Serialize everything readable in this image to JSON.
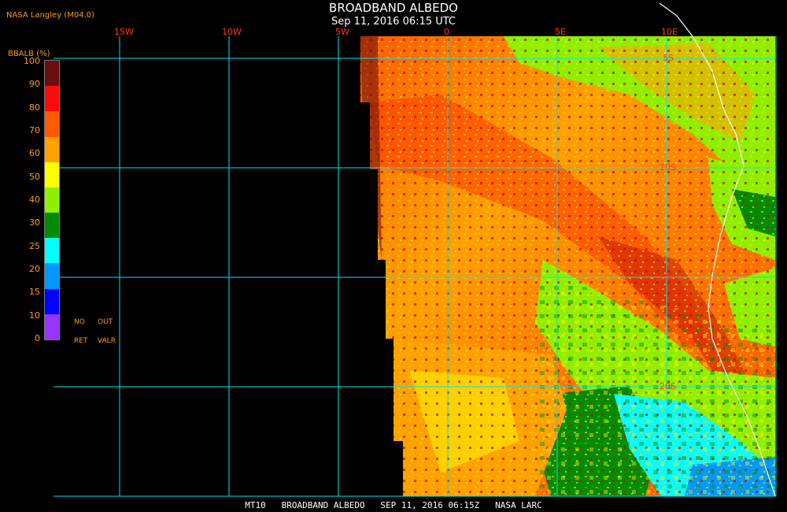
{
  "header": {
    "title": "BROADBAND ALBEDO",
    "subtitle": "Sep 11, 2016 06:15 UTC",
    "org": "NASA Langley (M04.0)"
  },
  "legend": {
    "title": "BBALB (%)",
    "ticks": [
      "100",
      "90",
      "80",
      "70",
      "60",
      "50",
      "40",
      "30",
      "25",
      "20",
      "15",
      "10",
      "0"
    ],
    "colors": [
      "#6e0d0d",
      "#ff0b0b",
      "#ff5a00",
      "#ffa100",
      "#ffff00",
      "#8ef000",
      "#008c00",
      "#00ffff",
      "#0099ff",
      "#0000ff",
      "#9933ff"
    ],
    "notes": {
      "no": "NO",
      "out": "OUT",
      "ret": "RET",
      "valr": "VALR"
    }
  },
  "map": {
    "lon_labels": [
      "15W",
      "10W",
      "5W",
      "0",
      "5E",
      "10E"
    ],
    "lat_labels": [
      "5S",
      "10S",
      "15S",
      "20S"
    ],
    "grid_color": "#00e5ee"
  },
  "footer": {
    "text": "MT10   BROADBAND ALBEDO   SEP 11, 2016 06:15Z   NASA LARC"
  }
}
